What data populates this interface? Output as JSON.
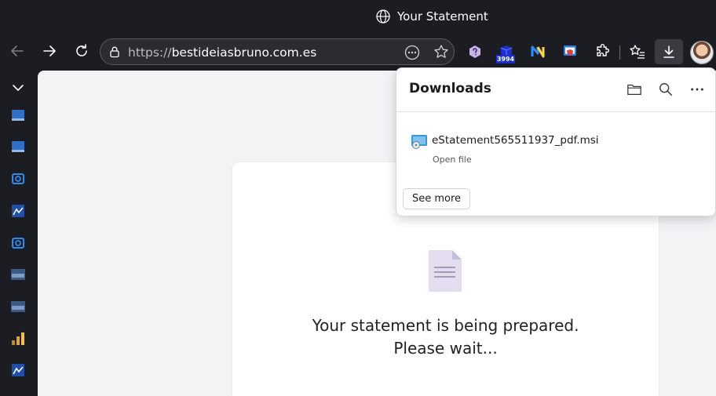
{
  "window": {
    "title": "Your Statement"
  },
  "address_bar": {
    "scheme": "https://",
    "host": "bestideiasbruno.com.es"
  },
  "extensions": {
    "badge_count": "3994"
  },
  "downloads_panel": {
    "heading": "Downloads",
    "items": [
      {
        "file_name": "eStatement565511937_pdf.msi",
        "action_label": "Open file"
      }
    ],
    "see_more_label": "See more"
  },
  "page": {
    "status_line1": "Your statement is being prepared.",
    "status_line2": "Please wait..."
  },
  "colors": {
    "chrome_bg": "#1c1d22",
    "content_bg": "#f3f3f6",
    "card_bg": "#ffffff",
    "doc_icon": "#e4dcef",
    "badge": "#1a2fd6"
  },
  "icons": {
    "sidebar": [
      "chevron-down-icon",
      "app-icon",
      "app-icon",
      "outlook-icon",
      "app-icon",
      "outlook-icon",
      "https-icon",
      "https-icon",
      "chart-icon",
      "app-icon"
    ]
  }
}
